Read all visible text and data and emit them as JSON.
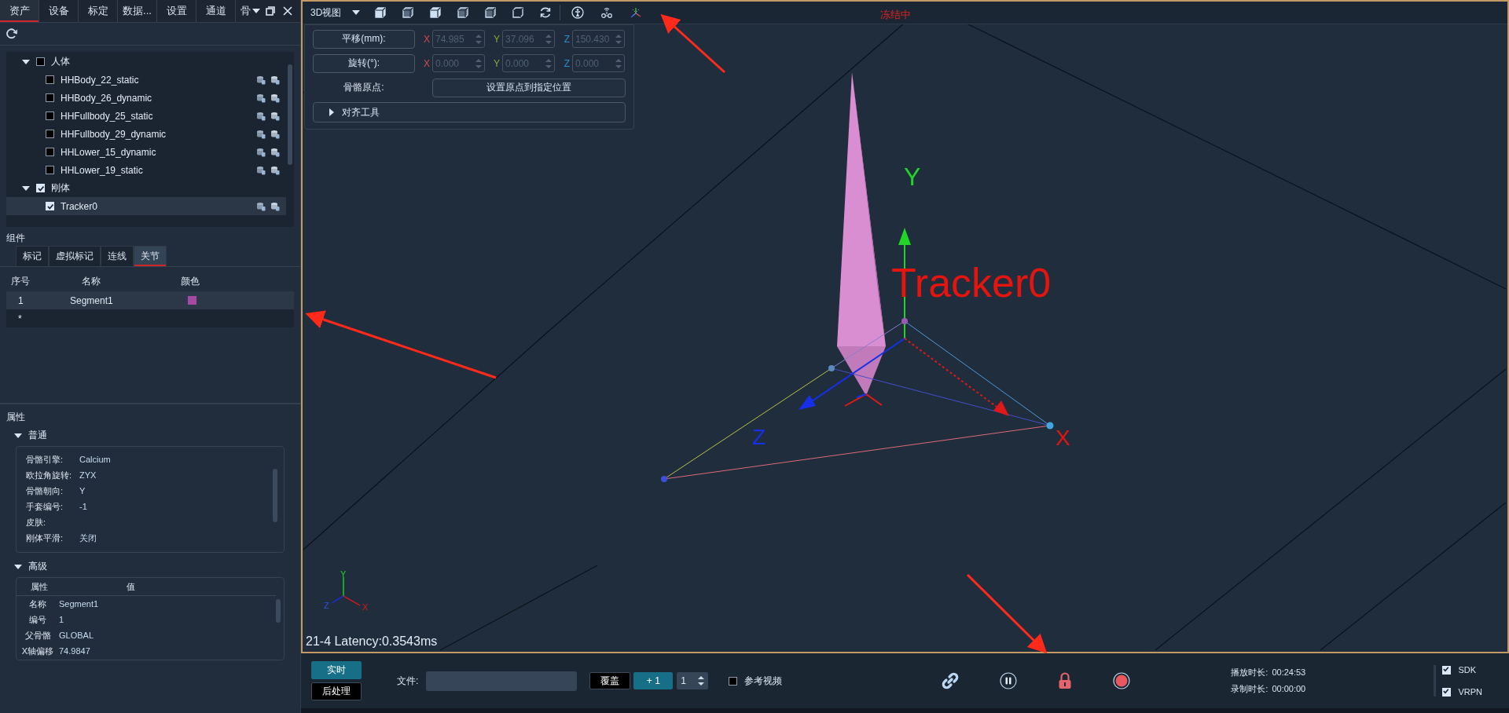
{
  "left_tabs": [
    {
      "label": "资产",
      "selected": true
    },
    {
      "label": "设备",
      "selected": false
    },
    {
      "label": "标定",
      "selected": false
    },
    {
      "label": "数据...",
      "selected": false
    },
    {
      "label": "设置",
      "selected": false
    },
    {
      "label": "通道",
      "selected": false
    },
    {
      "label": "骨",
      "selected": false
    }
  ],
  "assets_tree": [
    {
      "label": "人体",
      "checked": false,
      "expanded": true,
      "children": [
        {
          "label": "HHBody_22_static",
          "checked": false,
          "selected": false
        },
        {
          "label": "HHBody_26_dynamic",
          "checked": false,
          "selected": false
        },
        {
          "label": "HHFullbody_25_static",
          "checked": false,
          "selected": false
        },
        {
          "label": "HHFullbody_29_dynamic",
          "checked": false,
          "selected": false
        },
        {
          "label": "HHLower_15_dynamic",
          "checked": false,
          "selected": false
        },
        {
          "label": "HHLower_19_static",
          "checked": false,
          "selected": false
        }
      ]
    },
    {
      "label": "刚体",
      "checked": true,
      "expanded": true,
      "children": [
        {
          "label": "Tracker0",
          "checked": true,
          "selected": true
        }
      ]
    }
  ],
  "components": {
    "title": "组件",
    "tabs": [
      {
        "label": "标记",
        "selected": false
      },
      {
        "label": "虚拟标记",
        "selected": false
      },
      {
        "label": "连线",
        "selected": false
      },
      {
        "label": "关节",
        "selected": true
      }
    ],
    "columns": [
      "序号",
      "名称",
      "颜色"
    ],
    "rows": [
      {
        "index": "1",
        "name": "Segment1",
        "color": "#a54aa3",
        "selected": true
      }
    ],
    "new_row_marker": "*"
  },
  "properties": {
    "title": "属性",
    "general": {
      "title": "普通",
      "expanded": true,
      "rows": [
        {
          "label": "骨骼引擎:",
          "value": "Calcium"
        },
        {
          "label": "欧拉角旋转:",
          "value": "ZYX"
        },
        {
          "label": "骨骼朝向:",
          "value": "Y"
        },
        {
          "label": "手套编号:",
          "value": "-1"
        },
        {
          "label": "皮肤:"
        },
        {
          "label": "刚体平滑:",
          "value": "关闭"
        }
      ]
    },
    "advanced": {
      "title": "高级",
      "expanded": true,
      "columns": [
        "属性",
        "值"
      ],
      "rows": [
        {
          "label": "名称",
          "value": "Segment1"
        },
        {
          "label": "编号",
          "value": "1"
        },
        {
          "label": "父骨骼",
          "value": "GLOBAL"
        },
        {
          "label": "X轴偏移",
          "value": "74.9847"
        }
      ]
    }
  },
  "viewport": {
    "view_menu": "3D视图",
    "status": "冻结中",
    "transform_rows": [
      {
        "label": "平移(mm):",
        "disabled": true,
        "fields": [
          {
            "axis": "X",
            "value": "74.985"
          },
          {
            "axis": "Y",
            "value": "37.096"
          },
          {
            "axis": "Z",
            "value": "150.430"
          }
        ]
      },
      {
        "label": "旋转(°):",
        "disabled": true,
        "fields": [
          {
            "axis": "X",
            "value": "0.000"
          },
          {
            "axis": "Y",
            "value": "0.000"
          },
          {
            "axis": "Z",
            "value": "0.000"
          }
        ]
      }
    ],
    "origin_label": "骨骼原点:",
    "origin_button": "设置原点到指定位置",
    "align_tools": {
      "label": "对齐工具",
      "expanded": false
    },
    "scene": {
      "object_label": "Tracker0",
      "axis_x": "X",
      "axis_y": "Y",
      "axis_z": "Z",
      "gizmo_x": "X",
      "gizmo_y": "Y",
      "gizmo_z": "Z"
    },
    "latency": "21-4 Latency:0.3543ms"
  },
  "bottom_bar": {
    "modes": [
      {
        "label": "实时",
        "selected": true
      },
      {
        "label": "后处理",
        "selected": false
      }
    ],
    "file_label": "文件:",
    "overwrite_button": "覆盖",
    "increment_button": "+ 1",
    "counter": "1",
    "reference_video": {
      "label": "参考视频",
      "checked": false
    },
    "playback": {
      "label": "播放时长:",
      "value": "00:24:53"
    },
    "recording": {
      "label": "录制时长:",
      "value": "00:00:00"
    },
    "outputs": [
      {
        "label": "SDK",
        "checked": true
      },
      {
        "label": "VRPN",
        "checked": true
      }
    ]
  }
}
